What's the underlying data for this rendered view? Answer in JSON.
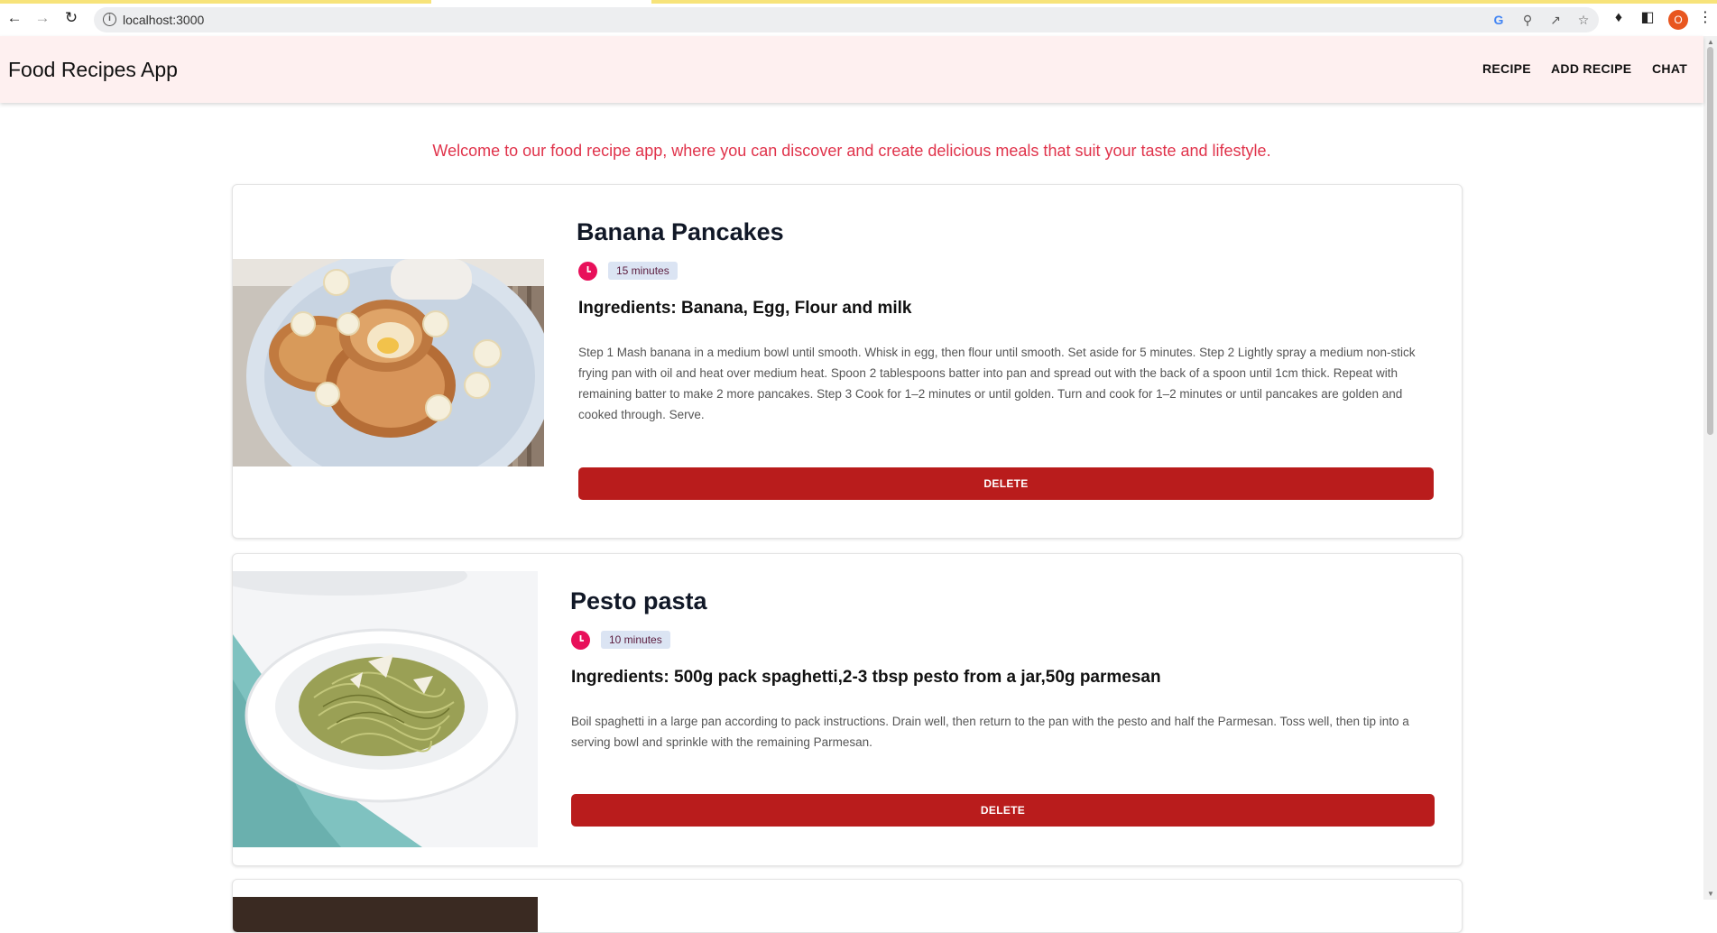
{
  "browser": {
    "url": "localhost:3000",
    "profile_initial": "O"
  },
  "app": {
    "title": "Food Recipes App",
    "nav": [
      "RECIPE",
      "ADD RECIPE",
      "CHAT"
    ],
    "welcome": "Welcome to our food recipe app, where you can discover and create delicious meals that suit your taste and lifestyle."
  },
  "recipes": [
    {
      "title": "Banana Pancakes",
      "time": "15 minutes",
      "ingredients": "Ingredients: Banana, Egg, Flour and milk",
      "steps": "Step 1 Mash banana in a medium bowl until smooth. Whisk in egg, then flour until smooth. Set aside for 5 minutes. Step 2 Lightly spray a medium non-stick frying pan with oil and heat over medium heat. Spoon 2 tablespoons batter into pan and spread out with the back of a spoon until 1cm thick. Repeat with remaining batter to make 2 more pancakes. Step 3 Cook for 1–2 minutes or until golden. Turn and cook for 1–2 minutes or until pancakes are golden and cooked through. Serve.",
      "delete_label": "DELETE"
    },
    {
      "title": "Pesto pasta",
      "time": "10 minutes",
      "ingredients": "Ingredients: 500g pack spaghetti,2-3 tbsp pesto from a jar,50g parmesan",
      "steps": "Boil spaghetti in a large pan according to pack instructions. Drain well, then return to the pan with the pesto and half the Parmesan. Toss well, then tip into a serving bowl and sprinkle with the remaining Parmesan.",
      "delete_label": "DELETE"
    }
  ],
  "colors": {
    "accent": "#e0334b",
    "appbar": "#fef0f0",
    "delete": "#b91c1c",
    "clock": "#e8105a"
  }
}
